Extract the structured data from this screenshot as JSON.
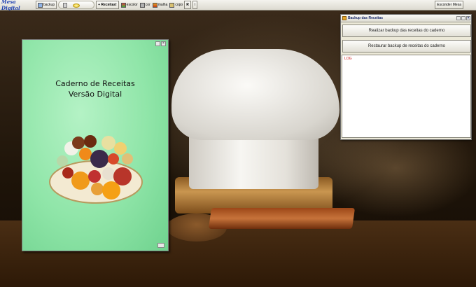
{
  "toolbar": {
    "brand": "Mesa Digital",
    "backup_label": "backup",
    "receitas_label": "+ Receitas!",
    "tools": [
      {
        "label": "escolor",
        "icon": "paint-icon"
      },
      {
        "label": "cor",
        "icon": "color-icon"
      },
      {
        "label": "malha",
        "icon": "grid-icon"
      },
      {
        "label": "copo",
        "icon": "cup-icon"
      }
    ],
    "r_label": "R",
    "extra_label": "I",
    "hide_label": "Esconder Mesa"
  },
  "cookbook": {
    "title_line1": "Caderno de Receitas",
    "title_line2": "Versão Digital"
  },
  "backup_window": {
    "title": "Backup das Receitas",
    "backup_button": "Realizar backup das receitas do caderno",
    "restore_button": "Restaurar backup de receitas do caderno",
    "log_text": "LOG"
  },
  "colors": {
    "brand_blue": "#1d3fb0",
    "cookbook_green": "#8fe5a8",
    "log_red": "#cc1111"
  }
}
